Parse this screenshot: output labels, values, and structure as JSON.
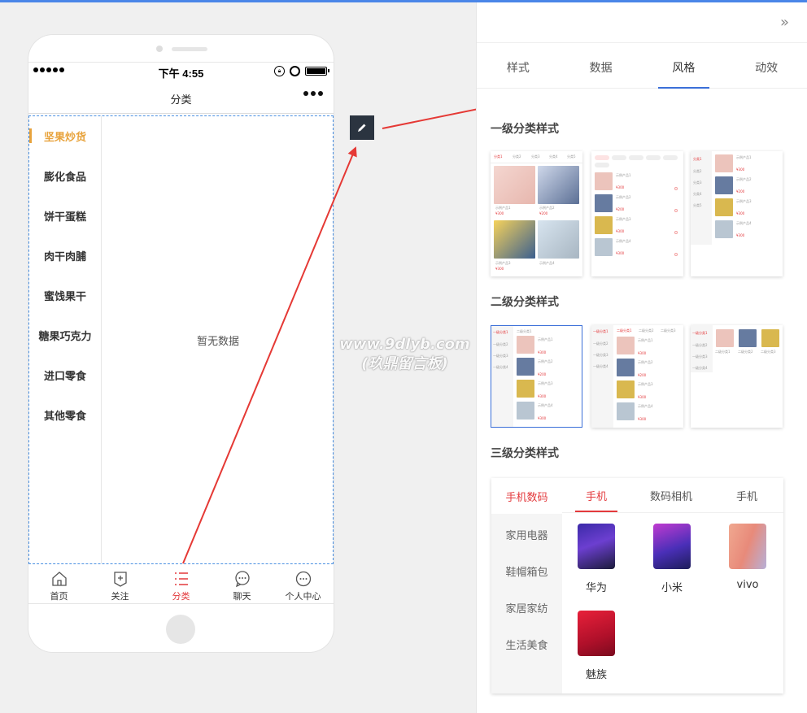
{
  "phone": {
    "time": "下午 4:55",
    "nav_title": "分类",
    "categories": [
      "坚果炒货",
      "膨化食品",
      "饼干蛋糕",
      "肉干肉脯",
      "蜜饯果干",
      "糖果巧克力",
      "进口零食",
      "其他零食"
    ],
    "active_category": "坚果炒货",
    "empty_text": "暂无数据",
    "tabs": [
      {
        "label": "首页",
        "icon": "home-icon"
      },
      {
        "label": "关注",
        "icon": "follow-icon"
      },
      {
        "label": "分类",
        "icon": "list-icon"
      },
      {
        "label": "聊天",
        "icon": "chat-icon"
      },
      {
        "label": "个人中心",
        "icon": "user-center-icon"
      }
    ],
    "active_tab": "分类"
  },
  "watermark": {
    "line1": "www.9dlyb.com",
    "line2": "(玖鼎留言板)"
  },
  "panel": {
    "tabs": [
      "样式",
      "数据",
      "风格",
      "动效"
    ],
    "active_tab": "风格",
    "level1_title": "一级分类样式",
    "level2_title": "二级分类样式",
    "level3_title": "三级分类样式",
    "mini": {
      "tabs": [
        "分类1",
        "分类2",
        "分类3",
        "分类4",
        "分类5"
      ],
      "cats": [
        "一级分类1",
        "一级分类2",
        "一级分类3",
        "一级分类4"
      ],
      "subs": [
        "二级分类1",
        "二级分类2",
        "二级分类3"
      ],
      "products": [
        "示例产品1",
        "示例产品2",
        "示例产品3",
        "示例产品4"
      ],
      "price": "¥300",
      "price2": "¥200"
    },
    "level3": {
      "left": [
        "手机数码",
        "家用电器",
        "鞋帽箱包",
        "家居家纺",
        "生活美食"
      ],
      "tabs": [
        "手机",
        "数码相机",
        "手机"
      ],
      "products": [
        "华为",
        "小米",
        "vivo",
        "魅族"
      ]
    },
    "colors": {
      "accent": "#e3393c",
      "tab_underline": "#3b6fd8",
      "category_active": "#e8a33c"
    }
  }
}
